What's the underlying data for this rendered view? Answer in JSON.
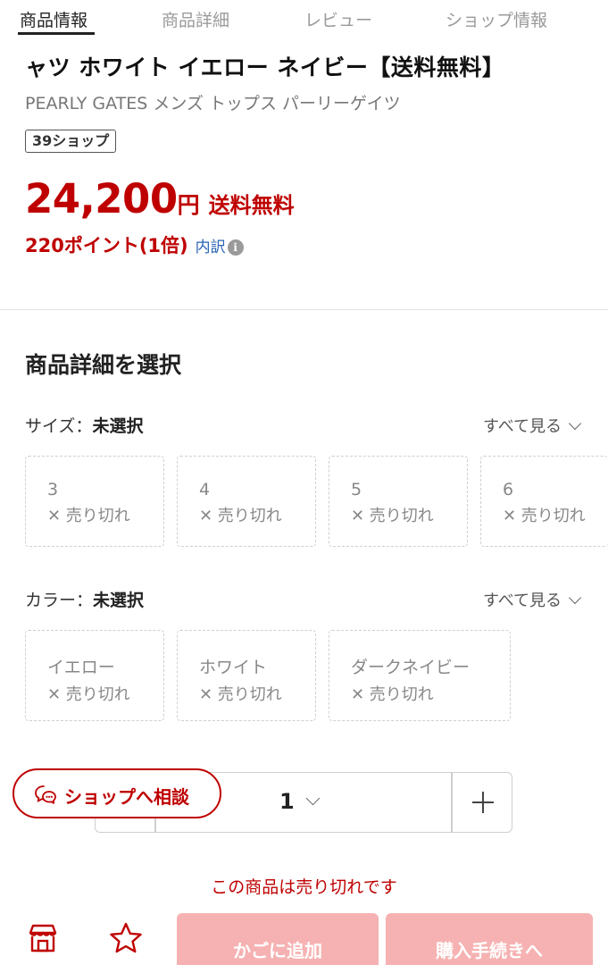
{
  "tabs": [
    {
      "label": "商品情報",
      "active": true
    },
    {
      "label": "商品詳細",
      "active": false
    },
    {
      "label": "レビュー",
      "active": false
    },
    {
      "label": "ショップ情報",
      "active": false
    }
  ],
  "product": {
    "title": "ャツ ホワイト イエロー ネイビー【送料無料】",
    "brand_line": "PEARLY GATES メンズ トップス パーリーゲイツ",
    "shop_badge": "39ショップ",
    "price": "24,200",
    "price_unit": "円",
    "shipping": "送料無料",
    "points": "220ポイント(1倍)",
    "points_breakdown": "内訳",
    "info_icon": "i"
  },
  "selection": {
    "section_title": "商品詳細を選択",
    "size": {
      "label": "サイズ：",
      "value": "未選択",
      "see_all": "すべて見る",
      "options": [
        {
          "name": "3",
          "status": "✕ 売り切れ"
        },
        {
          "name": "4",
          "status": "✕ 売り切れ"
        },
        {
          "name": "5",
          "status": "✕ 売り切れ"
        },
        {
          "name": "6",
          "status": "✕ 売り切れ"
        }
      ]
    },
    "color": {
      "label": "カラー：",
      "value": "未選択",
      "see_all": "すべて見る",
      "options": [
        {
          "name": "イエロー",
          "status": "✕ 売り切れ"
        },
        {
          "name": "ホワイト",
          "status": "✕ 売り切れ"
        },
        {
          "name": "ダークネイビー",
          "status": "✕ 売り切れ"
        }
      ]
    }
  },
  "quantity": {
    "value": "1"
  },
  "consult_button": {
    "label": "ショップへ相談"
  },
  "soldout_message": "この商品は売り切れです",
  "bottom_bar": {
    "cart_label": "かごに追加",
    "buy_label": "購入手続きへ"
  },
  "colors": {
    "accent_red": "#bf0000",
    "disabled_button": "#f6b2b2",
    "link_blue": "#2b63b5"
  },
  "icons": [
    "info-icon",
    "chevron-down-icon",
    "plus-icon",
    "chat-icon",
    "shop-icon",
    "star-icon"
  ]
}
